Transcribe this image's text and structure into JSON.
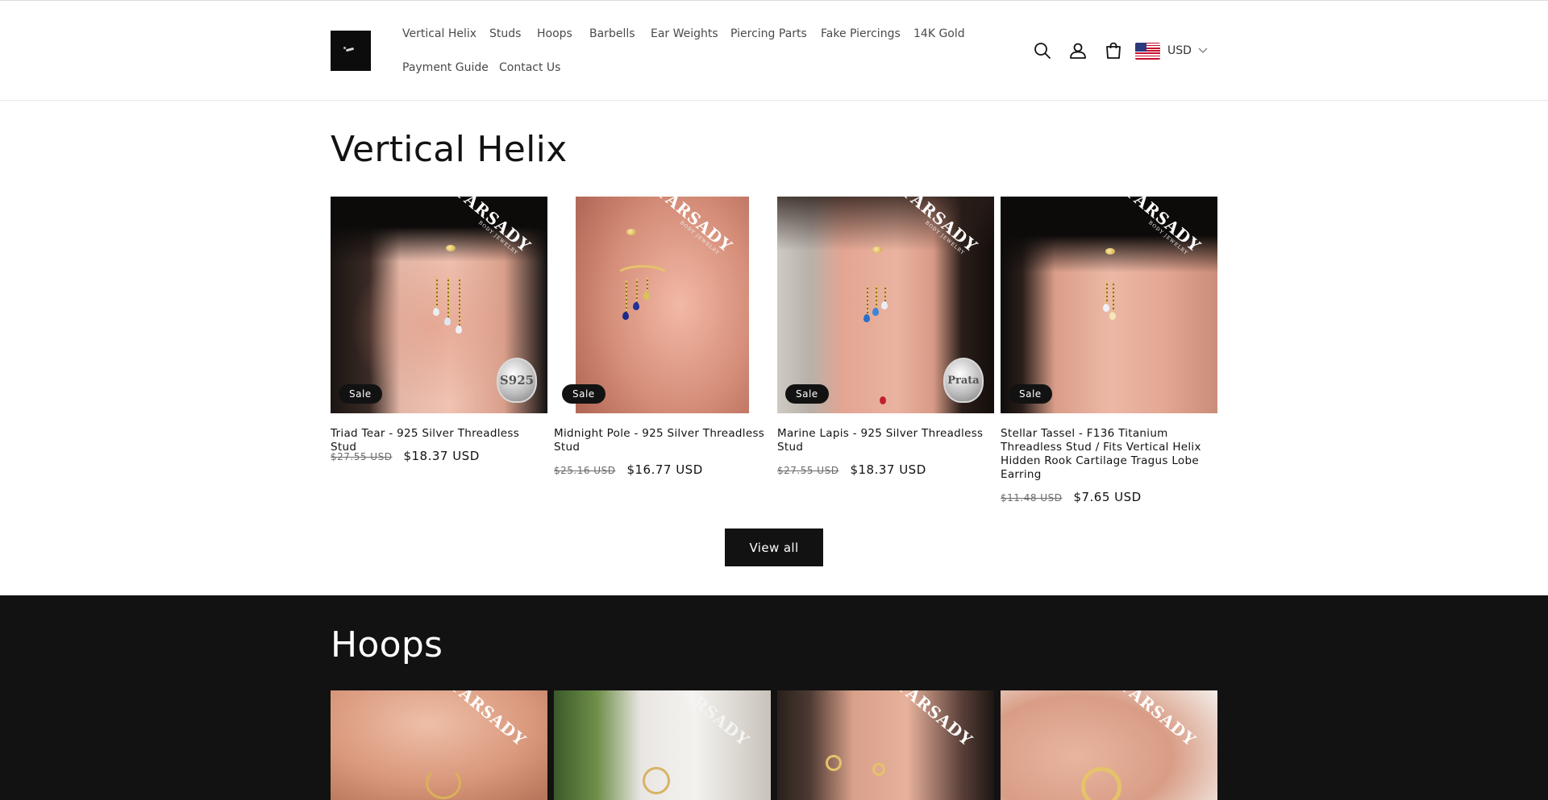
{
  "header": {
    "logo_alt": "Farsady logo",
    "nav": [
      {
        "label": "Vertical Helix"
      },
      {
        "label": "Studs"
      },
      {
        "label": "Hoops"
      },
      {
        "label": "Barbells"
      },
      {
        "label": "Ear Weights"
      },
      {
        "label": "Piercing Parts"
      },
      {
        "label": "Fake Piercings"
      },
      {
        "label": "14K Gold"
      },
      {
        "label": "Payment Guide"
      },
      {
        "label": "Contact Us"
      }
    ],
    "icons": [
      "search-icon",
      "account-icon",
      "cart-icon"
    ],
    "currency": "USD",
    "flag": "us-flag-icon"
  },
  "section_vertical_helix": {
    "title": "Vertical Helix",
    "products": [
      {
        "title": "Triad Tear - 925 Silver Threadless Stud",
        "badge": "Sale",
        "price_old": "$27.55 USD",
        "price_new": "$18.37 USD",
        "watermark": "FARSADY",
        "watermark_sub": "BODY JEWELRY",
        "seal": "S925"
      },
      {
        "title": "Midnight Pole - 925 Silver Threadless Stud",
        "badge": "Sale",
        "price_old": "$25.16 USD",
        "price_new": "$16.77 USD",
        "watermark": "FARSADY",
        "watermark_sub": "BODY JEWELRY"
      },
      {
        "title": "Marine Lapis - 925 Silver Threadless Stud",
        "badge": "Sale",
        "price_old": "$27.55 USD",
        "price_new": "$18.37 USD",
        "watermark": "FARSADY",
        "watermark_sub": "BODY JEWELRY",
        "seal": "Prata"
      },
      {
        "title": "Stellar Tassel - F136 Titanium Threadless Stud / Fits Vertical Helix Hidden Rook Cartilage Tragus Lobe Earring",
        "badge": "Sale",
        "price_old": "$11.48 USD",
        "price_new": "$7.65 USD",
        "watermark": "FARSADY",
        "watermark_sub": "BODY JEWELRY"
      }
    ],
    "view_all": "View all"
  },
  "section_hoops": {
    "title": "Hoops",
    "products": [
      {
        "watermark": "FARSADY"
      },
      {
        "watermark": "FARSADY"
      },
      {
        "watermark": "FARSADY"
      },
      {
        "watermark": "FARSADY"
      }
    ]
  },
  "colors": {
    "text": "#121212",
    "nav_text": "#4a4a4a",
    "dark_section": "#121212",
    "button": "#121212",
    "badge": "#121212"
  }
}
